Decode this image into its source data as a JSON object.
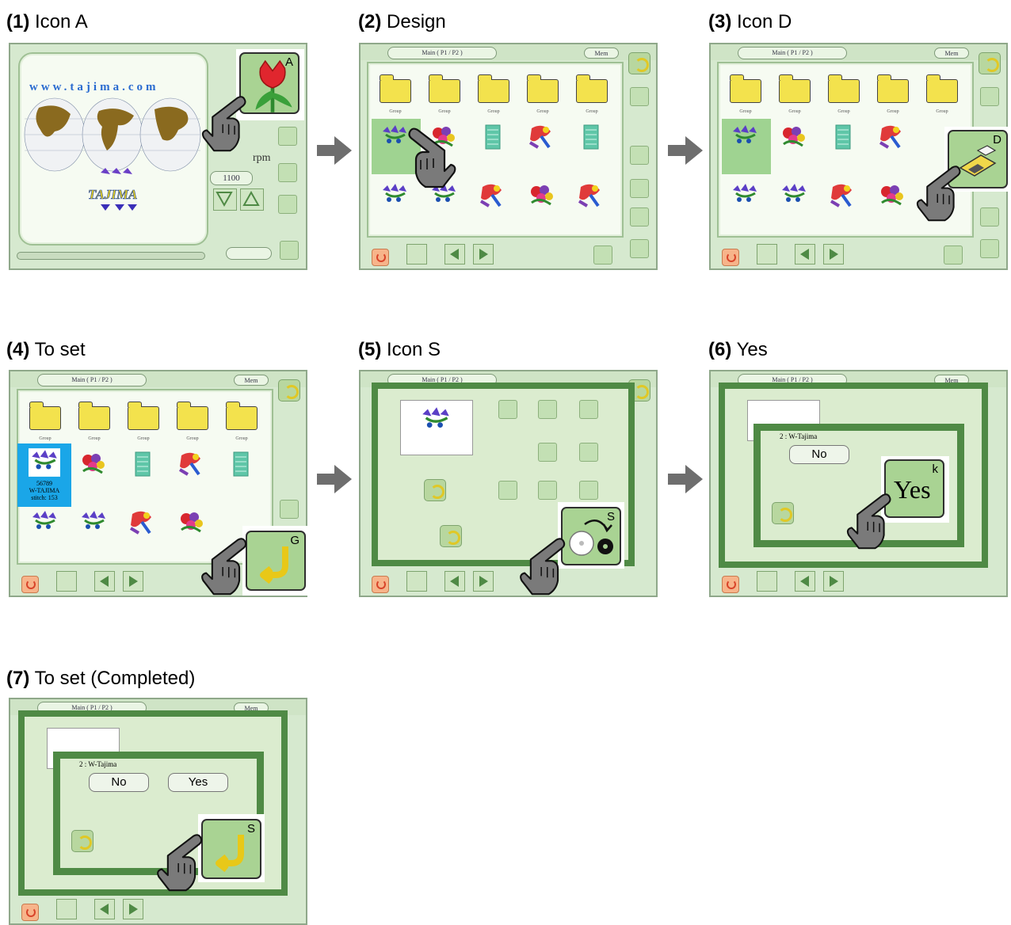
{
  "steps": [
    {
      "num": "(1)",
      "label": "Icon A",
      "callout": "A"
    },
    {
      "num": "(2)",
      "label": "Design"
    },
    {
      "num": "(3)",
      "label": "Icon D",
      "callout": "D"
    },
    {
      "num": "(4)",
      "label": "To set",
      "callout": "G"
    },
    {
      "num": "(5)",
      "label": "Icon S",
      "callout": "S"
    },
    {
      "num": "(6)",
      "label": "Yes",
      "callout": "k"
    },
    {
      "num": "(7)",
      "label": "To set (Completed)",
      "callout": "S"
    }
  ],
  "screen": {
    "folder_label": "Group",
    "header_pill": "Main ( P1 / P2 )",
    "status_pill": "Mem",
    "rpm_unit": "rpm",
    "speed_value": "1100",
    "website": "www.tajima.com",
    "brand": "TAJIMA"
  },
  "selected_design": {
    "line1": "56789",
    "line2": "W-TAJIMA",
    "line3": "stitch: 153"
  },
  "dialog": {
    "title": "2 : W-Tajima",
    "no_label": "No",
    "yes_label": "Yes"
  },
  "colors": {
    "screen_bg": "#d6e9cf",
    "frame_green": "#4f8a45",
    "arrow_gray": "#6e6e6e",
    "hand_gray": "#7a7a7a",
    "selection_blue": "#1aa6e8",
    "button_green": "#a9d393"
  },
  "icons": [
    "tulip-icon",
    "hand-pointer-icon",
    "arrow-right-icon",
    "folder-icon",
    "return-arrow-icon",
    "disk-icon",
    "pc-icon"
  ]
}
